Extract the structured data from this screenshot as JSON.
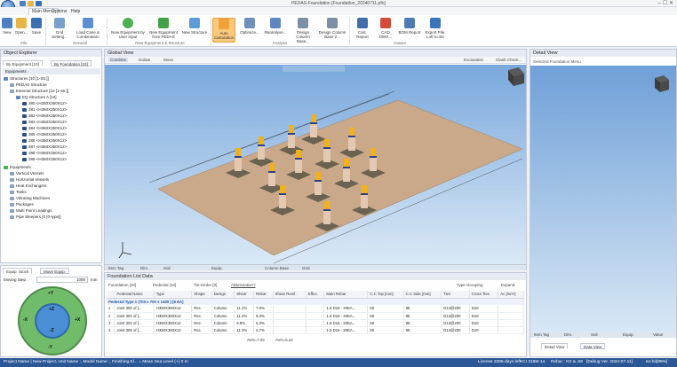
{
  "window": {
    "title": "PEDAS-Foundation [Foundation_20240711.pfn]"
  },
  "menu": {
    "items": [
      "Main Menu",
      "Options",
      "Help"
    ]
  },
  "ribbon": {
    "buttons": [
      {
        "label": "New",
        "color": "#4a7fc1"
      },
      {
        "label": "Open...",
        "color": "#e5b547"
      },
      {
        "label": "Save",
        "color": "#3a6fb3"
      },
      {
        "label": "Grid Setting...",
        "color": "#7aa0cc"
      },
      {
        "label": "Load Case & Combination",
        "color": "#5b8fd0"
      },
      {
        "label": "New Equipment by User Input",
        "color": "#4caf50"
      },
      {
        "label": "New Equipment from PEDAS",
        "color": "#43a047"
      },
      {
        "label": "New Structure",
        "color": "#5d9ad6"
      },
      {
        "label": "Auto Calculation",
        "color": "#f2a23a"
      },
      {
        "label": "Optimize...",
        "color": "#6e91bc"
      },
      {
        "label": "Reanalyse...",
        "color": "#5f86c0"
      },
      {
        "label": "Design Column Base...",
        "color": "#7d8ea5"
      },
      {
        "label": "Design Column Base 2...",
        "color": "#7d8ea5"
      },
      {
        "label": "Calc. Report",
        "color": "#3f6ea8"
      },
      {
        "label": "CAD DWG...",
        "color": "#d34b3a"
      },
      {
        "label": "BOM Report",
        "color": "#4e7bb5"
      },
      {
        "label": "Export Pile. Loft to ste",
        "color": "#3a73b8"
      }
    ],
    "groups": [
      "File",
      "General",
      "New Equipment & Structure",
      "Analysis",
      "Output"
    ]
  },
  "explorer": {
    "title": "Object Explorer",
    "tabs": [
      "By Equipment [10]",
      "By Foundation [10]"
    ],
    "section": "Equipments",
    "tree": [
      "Structures [10 [1-Str.]]",
      "PEDAS Structure",
      "External Structure [10 [1-Str.]]",
      "EQ Structure A [10]",
      "380 <H350X350X12>",
      "381 <H350X350X12>",
      "382 <H350X350X12>",
      "383 <H350X350X12>",
      "384 <H350X350X12>",
      "385 <H350X350X12>",
      "386 <H350X350X12>",
      "387 <H350X350X12>",
      "388 <H350X350X12>",
      "389 <H350X350X12>",
      "Equipments",
      "Vertical Vessels",
      "Horizontal Vessels",
      "Heat Exchangers",
      "Tanks",
      "Vibrating Machines",
      "Packages",
      "Multi Point Loadings",
      "Pipe Sleepers [0 [0-type]]"
    ]
  },
  "leftbottom": {
    "tabs": [
      "Equip. Stock",
      "Move Equip."
    ],
    "moving_step_label": "Moving Step :",
    "moving_step_value": "1000",
    "unit": "mm",
    "joy": [
      "+Z",
      "-Z",
      "+Y",
      "-Y",
      "+X",
      "-X"
    ]
  },
  "globalview": {
    "title": "Global View",
    "tools": [
      "Combine",
      "Isolate",
      "Move"
    ],
    "right_buttons": [
      "Excavation",
      "Clash Check..."
    ]
  },
  "viewtoolbar": {
    "items": [
      "Item Tag",
      "Dim.",
      "Soil",
      "Equip.",
      "Column Base",
      "Grid"
    ]
  },
  "list": {
    "title": "Foundation List Data",
    "tabs": [
      "Foundation [10]",
      "Pedestal [10]",
      "Tie-Girder [0]",
      "Abbreviation?"
    ],
    "checks": [
      "Type Grouping",
      "Expand"
    ],
    "group_row": "Pedestal Type 1 (700 x 700 x 1400 ) [8 EA]",
    "columns": [
      "",
      "Pedestal Name",
      "Type",
      "Shape",
      "Design",
      "Shear",
      "Rebar",
      "Shear Reinf.",
      "Effec.",
      "Main Rebar",
      "C.C Top [mm]",
      "C.C Side [mm]",
      "Ties",
      "Cross Ties",
      "Ac [mm²]"
    ],
    "rows": [
      [
        "1",
        "Joint 300 of [...",
        "H350X350X12",
        "Rec.",
        "Column",
        "11.1%",
        "7.0%",
        "",
        "",
        "1.5 D16 - 20EA...",
        "50",
        "95",
        "D13@200",
        "D10",
        ""
      ],
      [
        "2",
        "Joint 301 of [...",
        "H350X350X12",
        "Rec.",
        "Column",
        "11.4%",
        "8.3%",
        "",
        "",
        "1.5 D16 - 20EA...",
        "50",
        "95",
        "D13@200",
        "D10",
        ""
      ],
      [
        "3",
        "Joint 302 of [...",
        "H350X350X12",
        "Rec.",
        "Column",
        "9.8%",
        "6.3%",
        "",
        "",
        "1.5 D16 - 20EA...",
        "50",
        "95",
        "D13@200",
        "D10",
        ""
      ],
      [
        "4",
        "Joint 305 of [...",
        "H350X350X12",
        "Rec.",
        "Column",
        "11.3%",
        "6.7%",
        "",
        "",
        "1.5 D16 - 20EA...",
        "50",
        "95",
        "D13@200",
        "D10",
        ""
      ]
    ],
    "avg": [
      "AVG=7.03",
      "AVG=5.22"
    ]
  },
  "detail": {
    "title": "Detail View",
    "selected": "Selected Foundation Menu",
    "tabs": [
      "Detail View",
      "Data View"
    ],
    "toolbar": [
      "Item Tag",
      "Dim.",
      "Soil",
      "Equip.",
      "Value"
    ]
  },
  "status": {
    "left": "Project Name | New Project, Unit Name :, Model Name :, Finishing El... = Mean Sea Level (+) 0 m",
    "right": [
      "License 2365-days left",
      "ACI 318M-14",
      "Rebar : KS & JIS",
      "[Debug Ver. 2024-07-11]",
      "64-bit[99%]"
    ]
  },
  "colors": {
    "status": "#2b5797",
    "viewport_top": "#79a8dc",
    "slab": "#c9a98a"
  }
}
